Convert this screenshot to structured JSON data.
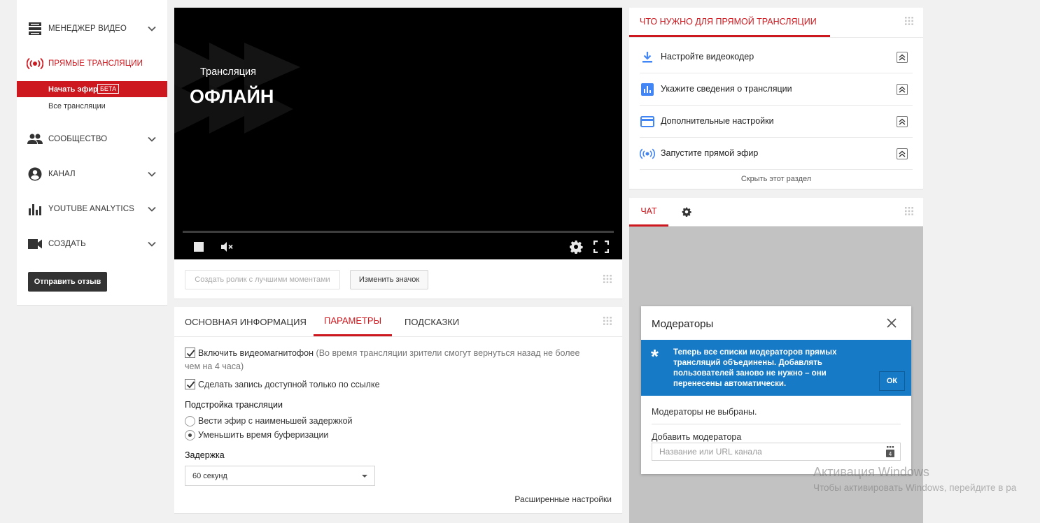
{
  "sidebar": {
    "items": [
      {
        "label": "МЕНЕДЖЕР ВИДЕО",
        "icon": "video-manager-icon"
      },
      {
        "label": "ПРЯМЫЕ ТРАНСЛЯЦИИ",
        "icon": "live-broadcast-icon",
        "active": true
      },
      {
        "label": "СООБЩЕСТВО",
        "icon": "community-icon"
      },
      {
        "label": "КАНАЛ",
        "icon": "channel-icon"
      },
      {
        "label": "YOUTUBE ANALYTICS",
        "icon": "analytics-icon"
      },
      {
        "label": "СОЗДАТЬ",
        "icon": "create-icon"
      }
    ],
    "sub_items": [
      {
        "label": "Начать эфир",
        "badge": "БЕТА",
        "current": true
      },
      {
        "label": "Все трансляции"
      }
    ],
    "feedback_button": "Отправить отзыв"
  },
  "player": {
    "status_label": "Трансляция",
    "status_value": "ОФЛАЙН"
  },
  "under_player": {
    "highlights_button": "Создать ролик с лучшими моментами",
    "change_thumbnail_button": "Изменить значок"
  },
  "settings": {
    "tabs": [
      "ОСНОВНАЯ ИНФОРМАЦИЯ",
      "ПАРАМЕТРЫ",
      "ПОДСКАЗКИ"
    ],
    "active_tab": "ПАРАМЕТРЫ",
    "dvr": {
      "checked": true,
      "label": "Включить видеомагнитофон",
      "hint_line1": "(Во время трансляции зрители смогут вернуться назад не более",
      "hint_line2": "чем на 4 часа)"
    },
    "unlisted": {
      "checked": true,
      "label": "Сделать запись доступной только по ссылке"
    },
    "tuning_heading": "Подстройка трансляции",
    "latency_options": [
      {
        "label": "Вести эфир с наименьшей задержкой",
        "selected": false
      },
      {
        "label": "Уменьшить время буферизации",
        "selected": true
      }
    ],
    "delay_heading": "Задержка",
    "delay_value": "60 секунд",
    "advanced_link": "Расширенные настройки"
  },
  "checklist": {
    "title": "ЧТО НУЖНО ДЛЯ ПРЯМОЙ ТРАНСЛЯЦИИ",
    "items": [
      {
        "label": "Настройте видеокодер",
        "icon": "download-icon"
      },
      {
        "label": "Укажите сведения о трансляции",
        "icon": "info-chart-icon"
      },
      {
        "label": "Дополнительные настройки",
        "icon": "card-icon"
      },
      {
        "label": "Запустите прямой эфир",
        "icon": "broadcast-icon"
      }
    ],
    "hide_link": "Скрыть этот раздел"
  },
  "chat": {
    "tab_label": "ЧАТ"
  },
  "moderators_dialog": {
    "title": "Модераторы",
    "notice": "Теперь все списки модераторов прямых трансляций объединены. Добавлять пользователей заново не нужно – они перенесены автоматически.",
    "ok_button": "ОК",
    "empty_text": "Модераторы не выбраны.",
    "add_label": "Добавить модератора",
    "input_placeholder": "Название или URL канала"
  },
  "watermark": {
    "title": "Активация Windows",
    "text": "Чтобы активировать Windows, перейдите в ра"
  },
  "colors": {
    "accent": "#cc181e",
    "info_blue": "#167ac6",
    "icon_blue": "#4285f4"
  }
}
